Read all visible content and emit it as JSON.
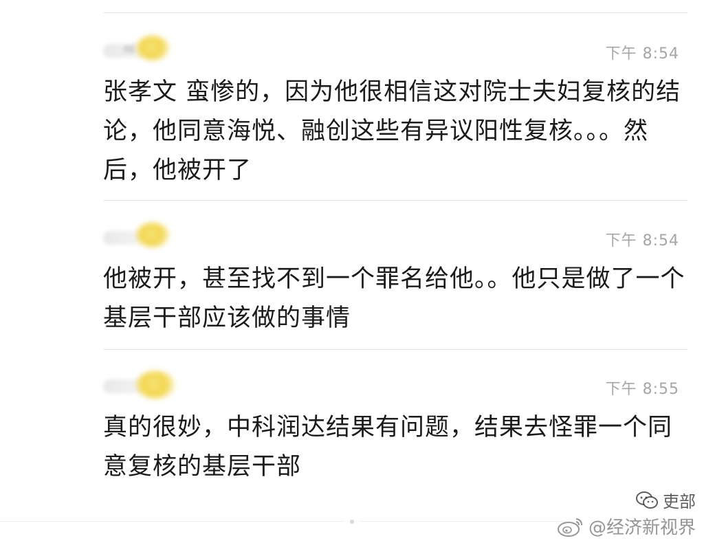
{
  "messages": [
    {
      "sender_fragment": "ni",
      "time": "下午 8:54",
      "text": "张孝文 蛮惨的，因为他很相信这对院士夫妇复核的结论，他同意海悦、融创这些有异议阳性复核。。。然后，他被开了"
    },
    {
      "sender_fragment": "",
      "time": "下午 8:54",
      "text": "他被开，甚至找不到一个罪名给他。。他只是做了一个基层干部应该做的事情"
    },
    {
      "sender_fragment": "",
      "time": "下午 8:55",
      "text": "真的很妙，中科润达结果有问题，结果去怪罪一个同意复核的基层干部"
    }
  ],
  "watermark": {
    "account": "吏部",
    "weibo_handle": "@经济新视界",
    "icons": [
      "wechat-icon",
      "weibo-icon"
    ]
  },
  "colors": {
    "timestamp": "#a6a6a6",
    "text": "#1b1b1b",
    "divider": "#e6e6e6",
    "avatar_blur": "#f2d64e"
  }
}
